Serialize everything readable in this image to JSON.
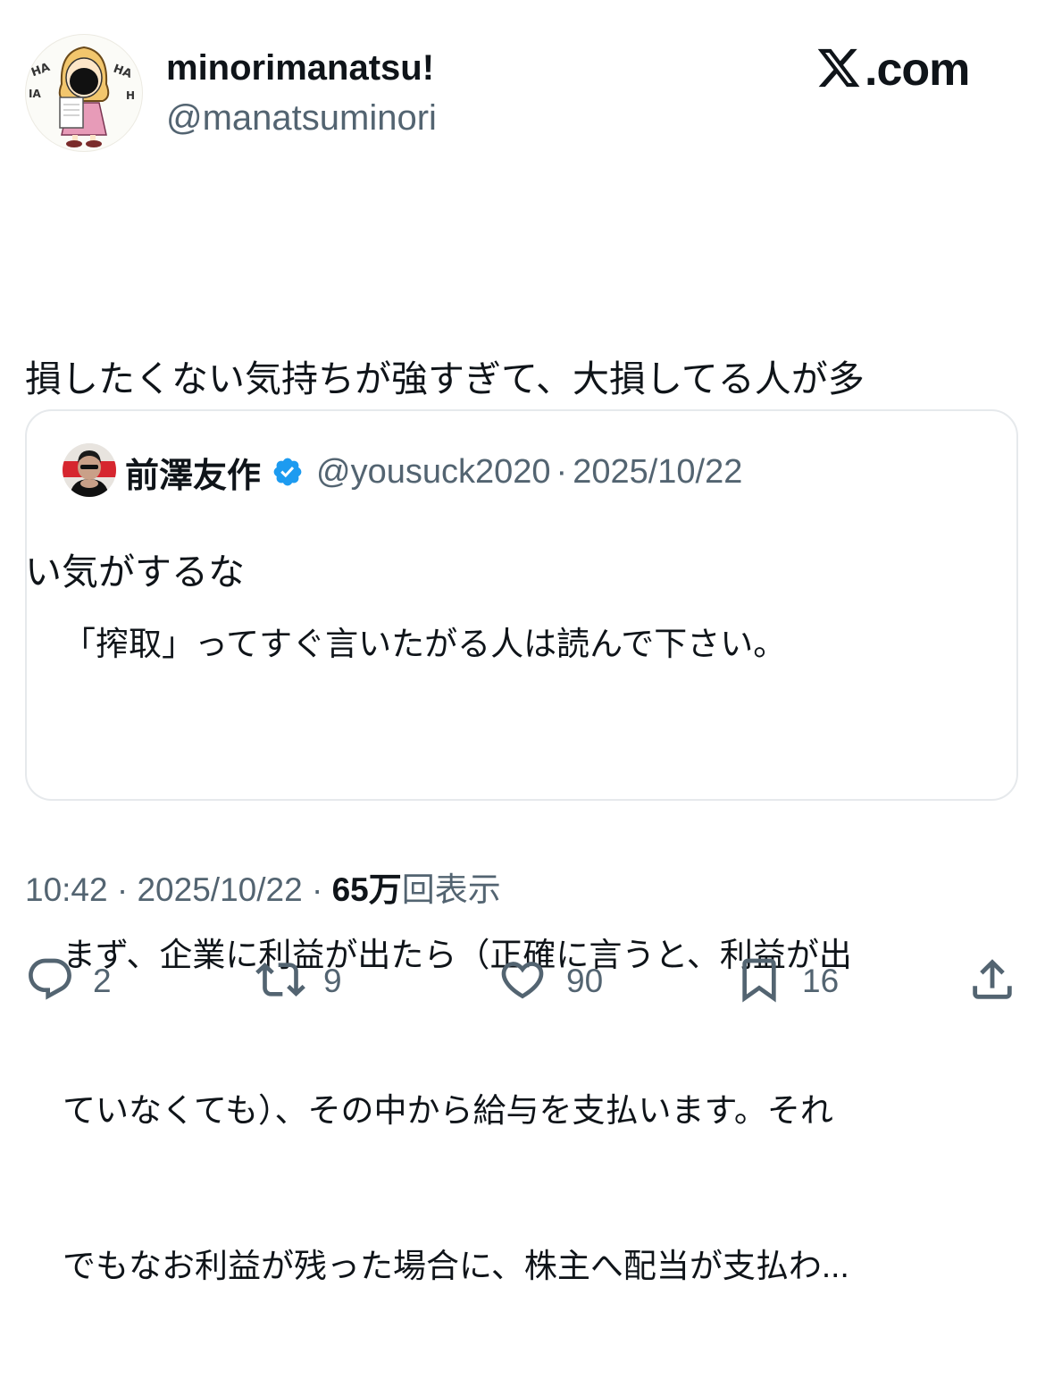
{
  "author": {
    "display_name": "minorimanatsu!",
    "handle": "@manatsuminori"
  },
  "brand": {
    "text": ".com"
  },
  "tweet": {
    "lines": [
      "損したくない気持ちが強すぎて、大損してる人が多",
      "い気がするな"
    ]
  },
  "quote": {
    "display_name": "前澤友作",
    "handle": "@yousuck2020",
    "separator": "·",
    "date": "2025/10/22",
    "lines": [
      "「搾取」ってすぐ言いたがる人は読んで下さい。",
      "",
      "まず、企業に利益が出たら（正確に言うと、利益が出",
      "ていなくても）、その中から給与を支払います。それ",
      "でもなお利益が残った場合に、株主へ配当が支払わ..."
    ]
  },
  "meta": {
    "time": "10:42",
    "separator": "·",
    "date": "2025/10/22",
    "views_count": "65万",
    "views_label": "回表示"
  },
  "actions": {
    "replies": "2",
    "reposts": "9",
    "likes": "90",
    "bookmarks": "16"
  },
  "colors": {
    "text_primary": "#0f1419",
    "text_secondary": "#536471",
    "border": "#e6e9ec",
    "verified": "#1d9bf0"
  },
  "icons": {
    "reply": "reply-icon",
    "repost": "repost-icon",
    "like": "heart-icon",
    "bookmark": "bookmark-icon",
    "share": "share-icon",
    "verified": "verified-badge-icon",
    "brand": "x-logo-icon"
  }
}
